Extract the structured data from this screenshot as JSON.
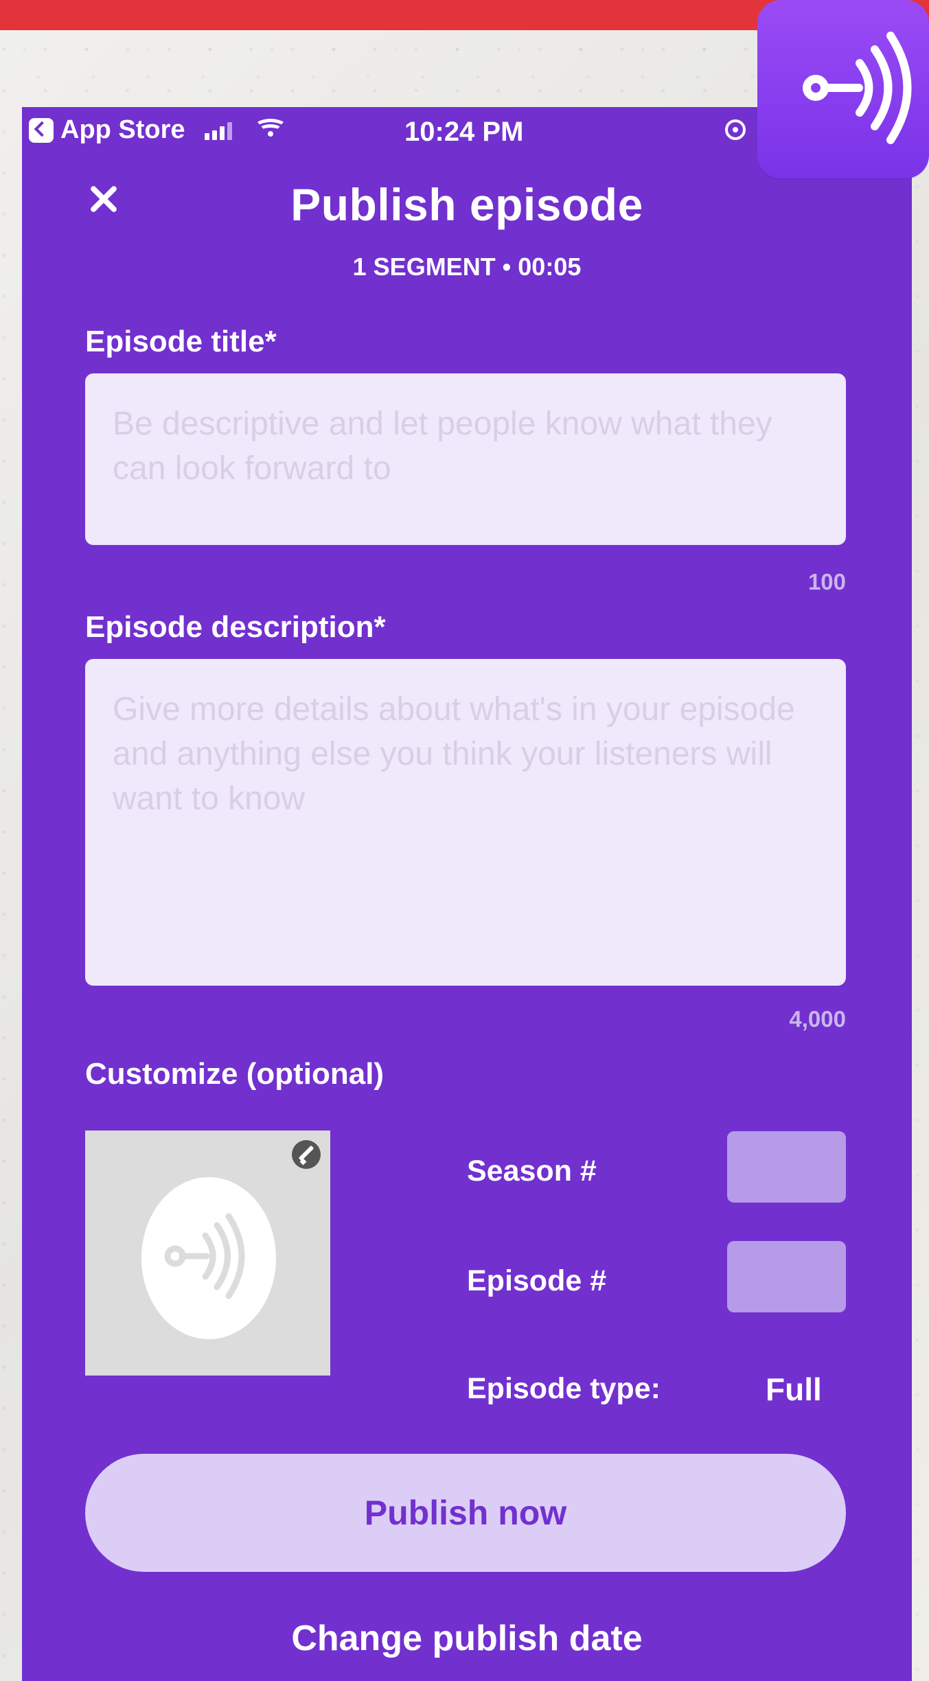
{
  "status_bar": {
    "carrier_label": "App Store",
    "time": "10:24 PM"
  },
  "header": {
    "title": "Publish episode",
    "subtitle": "1 SEGMENT • 00:05"
  },
  "episode_title": {
    "label": "Episode title*",
    "placeholder": "Be descriptive and let people know what they can look forward to",
    "limit": "100"
  },
  "episode_description": {
    "label": "Episode description*",
    "placeholder": "Give more details about what's in your episode and anything else you think your listeners will want to know",
    "limit": "4,000"
  },
  "customize": {
    "label": "Customize (optional)",
    "season_label": "Season #",
    "episode_label": "Episode #",
    "episode_type_label": "Episode type:",
    "episode_type_value": "Full"
  },
  "actions": {
    "publish_now": "Publish now",
    "change_publish_date": "Change publish date"
  },
  "theme": {
    "brand_purple": "#7230cf",
    "accent_red": "#e3343c"
  },
  "icons": {
    "close": "close-icon",
    "back": "chevron-left-icon",
    "signal": "signal-icon",
    "wifi": "wifi-icon",
    "location": "location-icon",
    "edit": "pencil-icon",
    "podcast": "podcast-icon",
    "brand": "brand-podcast-icon"
  }
}
